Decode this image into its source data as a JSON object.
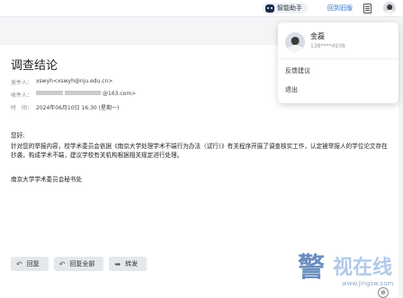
{
  "header": {
    "assistant_label": "智能助手",
    "return_old_label": "回到旧版"
  },
  "email": {
    "title": "调查结论",
    "from_label": "发件人：",
    "from_value": "xswyh<xswyh@nju.edu.cn>",
    "to_label": "收件人：",
    "to_value": "@163.com>",
    "time_label": "时　间：",
    "time_value": "2024年06月10日 16:30 (星期一)",
    "greeting": "您好:",
    "body": "针对您的举报内容，校学术委员会依据《南京大学处理学术不端行为办法（试行）》有关程序开展了调查核实工作，认定被举报人的学位论文存在抄袭，构成学术不端，建议学校有关机构根据相关规定进行处理。",
    "signature": "南京大学学术委员会秘书处"
  },
  "actions": {
    "reply": "回复",
    "reply_all": "回复全部",
    "forward": "转发"
  },
  "dropdown": {
    "user_name": "金磊",
    "user_phone": "138****4938",
    "feedback": "反馈建议",
    "logout": "退出"
  },
  "watermark": {
    "text": "视在线",
    "url": "www.jingsw.com"
  },
  "colors": {
    "accent": "#2f6fd6",
    "button_bg": "#e4e7ec",
    "page_bg": "#f4f5f7"
  }
}
